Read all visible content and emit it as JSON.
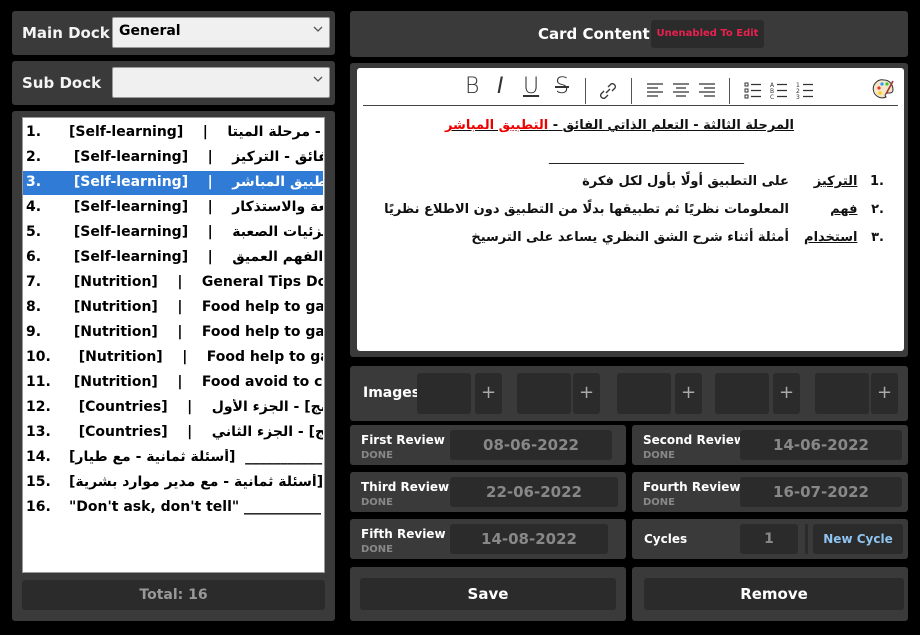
{
  "main_dock": {
    "label": "Main Dock",
    "value": "General"
  },
  "sub_dock": {
    "label": "Sub Dock",
    "value": ""
  },
  "list": [
    {
      "num": "1.",
      "text": "[Self-learning]    |    ﻲﺒ الفائق - مرحلة الميتا"
    },
    {
      "num": "2.",
      "text": " [Self-learning]    |    الذاتي الفائق - التركيز"
    },
    {
      "num": "3.",
      "text": " [Self-learning]    |    ﻔائق - التطبيق المباشر"
    },
    {
      "num": "4.",
      "text": " [Self-learning]    |    ﻖ - المراجعة والاستذكار"
    },
    {
      "num": "5.",
      "text": " [Self-learning]    |    ﻔائق - الجزئيات الصعبة"
    },
    {
      "num": "6.",
      "text": " [Self-learning]    |    الفائق - الفهم العميق"
    },
    {
      "num": "7.",
      "text": " [Nutrition]    |    General Tips Don't dri"
    },
    {
      "num": "8.",
      "text": " [Nutrition]    |    Food help to gain weig"
    },
    {
      "num": "9.",
      "text": " [Nutrition]    |    Food help to gain weig"
    },
    {
      "num": "10.",
      "text": "  [Nutrition]    |    Food help to gain wei"
    },
    {
      "num": "11.",
      "text": " [Nutrition]    |    Food avoid to consum"
    },
    {
      "num": "12.",
      "text": "  [Countries]    |    ﻮﻧﺞ ﻛﻮﻧﺞ] - الجزء الأول"
    },
    {
      "num": "13.",
      "text": "  [Countries]    |    ﻮﻧﺞ ﻛﻮﻧﺞ] - الجزء الثاني"
    },
    {
      "num": "14.",
      "text": "[أسئلة ثمانية - مع طيار]  ___________"
    },
    {
      "num": "15.",
      "text": "[أسئلة ثمانية - مع مدير موارد بشرية]  ______"
    },
    {
      "num": "16.",
      "text": "\"Don't ask, don't tell\" ___________"
    }
  ],
  "selected_index": 2,
  "total": "Total: 16",
  "card": {
    "title": "Card Content",
    "edit_badge": "Unenabled To Edit",
    "heading_plain": "المرحلة الثالثة  -  التعلم الذاتي الفائق - ",
    "heading_red": "التطبيق المباشر",
    "divider": "______________________________",
    "items": [
      {
        "num": ".1",
        "term": "التركيز",
        "desc": "على التطبيق أولًا بأول لكل فكرة"
      },
      {
        "num": ".٢",
        "term": "فهم",
        "desc": "المعلومات نظريًا ثم تطبيقها بدلًا من التطبيق دون الاطلاع نظريًا"
      },
      {
        "num": ".٣",
        "term": "استخدام",
        "desc": "أمثلة أثناء شرح الشق النظري يساعد على الترسيخ"
      }
    ]
  },
  "images_label": "Images",
  "plus": "+",
  "reviews": [
    {
      "title": "First Review",
      "status": "DONE",
      "date": "08-06-2022"
    },
    {
      "title": "Second Review",
      "status": "DONE",
      "date": "14-06-2022"
    },
    {
      "title": "Third Review",
      "status": "DONE",
      "date": "22-06-2022"
    },
    {
      "title": "Fourth Review",
      "status": "DONE",
      "date": "16-07-2022"
    },
    {
      "title": "Fifth Review",
      "status": "DONE",
      "date": "14-08-2022"
    }
  ],
  "cycles": {
    "label": "Cycles",
    "value": "1",
    "button": "New Cycle"
  },
  "buttons": {
    "save": "Save",
    "remove": "Remove"
  },
  "colors": {
    "accent_red": "#e8214f",
    "selection_blue": "#2f7bd6",
    "cycle_blue": "#8fc3f0"
  }
}
